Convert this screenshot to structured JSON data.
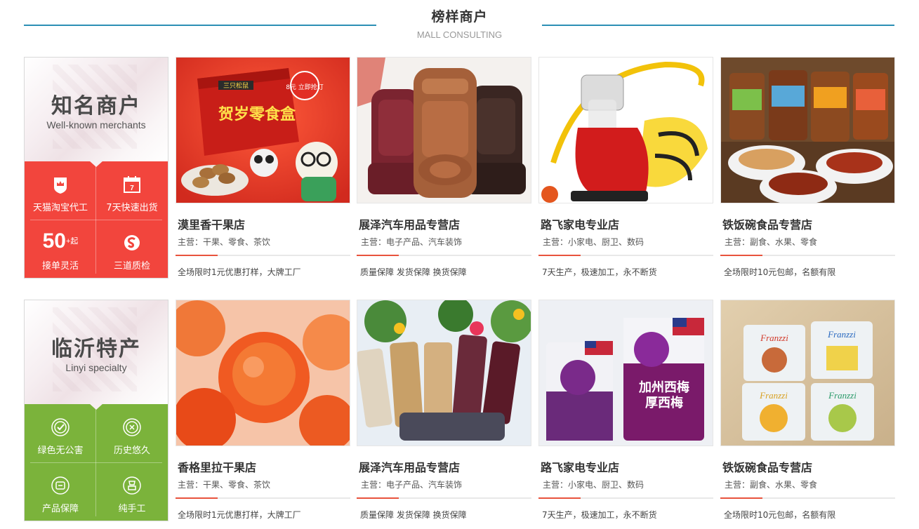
{
  "header": {
    "title": "榜样商户",
    "subtitle": "MALL CONSULTING"
  },
  "sections": [
    {
      "title": "知名商户",
      "subtitle": "Well-known merchants",
      "accent": "#f2453d",
      "features": [
        {
          "icon": "shop-badge-icon",
          "label": "天猫淘宝代工"
        },
        {
          "icon": "calendar-icon",
          "label": "7天快速出货",
          "icon_text": "7"
        },
        {
          "number": "50",
          "number_sup": "+",
          "number_sub": "起",
          "label": "接单灵活"
        },
        {
          "icon": "quality-check-icon",
          "label": "三道质检"
        }
      ],
      "cards": [
        {
          "name": "漠里香干果店",
          "main": "主营：干果、零食、茶饮",
          "promo": "全场限时1元优惠打样，大牌工厂",
          "image": "snack-gift-box-image",
          "image_text": "贺岁零食盒",
          "badge_text": "8元 立即抢订",
          "brand_text": "三只松鼠"
        },
        {
          "name": "展泽汽车用品专营店",
          "main": "主营：电子产品、汽车装饰",
          "promo": "质量保障 发货保障 换货保障",
          "image": "car-seat-covers-image"
        },
        {
          "name": "路飞家电专业店",
          "main": "主营：小家电、厨卫、数码",
          "promo": "7天生产，极速加工，永不断货",
          "image": "juicer-image"
        },
        {
          "name": "铁饭碗食品专营店",
          "main": "主营：副食、水果、零食",
          "promo": "全场限时10元包邮，名额有限",
          "image": "jerky-jars-image"
        }
      ]
    },
    {
      "title": "临沂特产",
      "subtitle": "Linyi specialty",
      "accent": "#7bb33b",
      "features": [
        {
          "icon": "green-check-icon",
          "label": "绿色无公害"
        },
        {
          "icon": "history-icon",
          "label": "历史悠久"
        },
        {
          "icon": "product-guarantee-icon",
          "label": "产品保障"
        },
        {
          "icon": "handmade-icon",
          "label": "纯手工"
        }
      ],
      "cards": [
        {
          "name": "香格里拉干果店",
          "main": "主营：干果、零食、茶饮",
          "promo": "全场限时1元优惠打样，大牌工厂",
          "image": "dried-apricots-image"
        },
        {
          "name": "展泽汽车用品专营店",
          "main": "主营：电子产品、汽车装饰",
          "promo": "质量保障 发货保障 换货保障",
          "image": "flower-tea-jars-image"
        },
        {
          "name": "路飞家电专业店",
          "main": "主营：小家电、厨卫、数码",
          "promo": "7天生产，极速加工，永不断货",
          "image": "dried-plum-bags-image",
          "image_text": "加州西梅",
          "brand_text": "厚西梅"
        },
        {
          "name": "铁饭碗食品专营店",
          "main": "主营：副食、水果、零食",
          "promo": "全场限时10元包邮，名额有限",
          "image": "cookie-packs-image",
          "brand_text": "Franzzi"
        }
      ]
    }
  ]
}
